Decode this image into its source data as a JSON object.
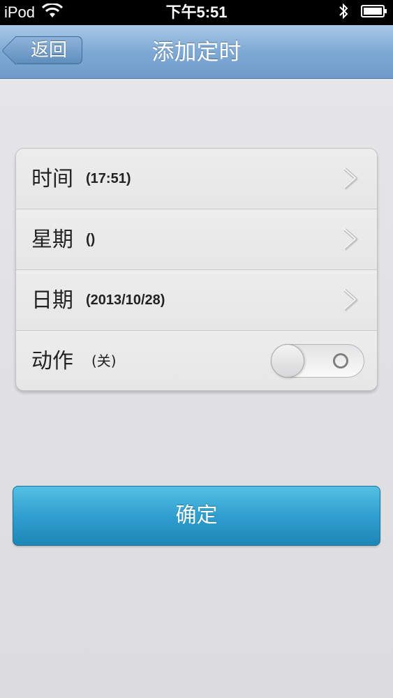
{
  "status_bar": {
    "carrier": "iPod",
    "time": "下午5:51"
  },
  "nav": {
    "back_label": "返回",
    "title": "添加定时"
  },
  "rows": [
    {
      "label": "时间",
      "value": "(17:51)"
    },
    {
      "label": "星期",
      "value": "()"
    },
    {
      "label": "日期",
      "value": "(2013/10/28)"
    },
    {
      "label": "动作",
      "value": "(关)"
    }
  ],
  "toggle": {
    "state": "off"
  },
  "confirm_label": "确定"
}
